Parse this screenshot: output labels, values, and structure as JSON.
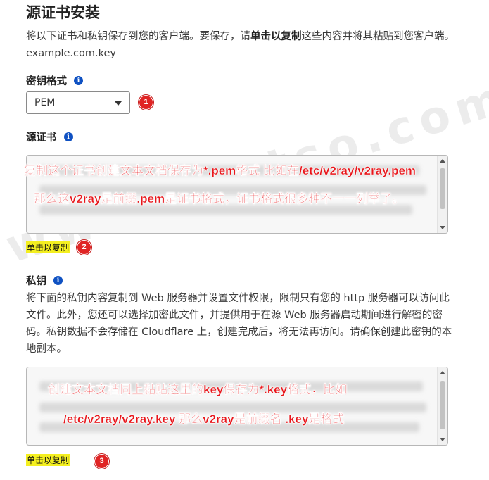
{
  "page": {
    "title": "源证书安装",
    "intro_prefix": "将以下证书和私钥保存到您的客户端。要保存，请",
    "intro_bold": "单击以复制",
    "intro_suffix": "这些内容并将其粘贴到您客户端。",
    "intro_line2": "example.com.key"
  },
  "key_format": {
    "label": "密钥格式",
    "info_icon": "i",
    "selected": "PEM",
    "marker": "1"
  },
  "origin_cert": {
    "label": "源证书",
    "info_icon": "i",
    "annotation_line1": "复制这个证书创建文本文档保存为*.pem格式 比如在/etc/v2ray/v2ray.pem",
    "annotation_line2": "那么这v2ray是前缀.pem是证书格式，证书格式很多种不一一列举了。",
    "copy_label": "单击以复制",
    "marker": "2"
  },
  "private_key": {
    "label": "私钥",
    "info_icon": "i",
    "description": "将下面的私钥内容复制到 Web 服务器并设置文件权限，限制只有您的 http 服务器可以访问此文件。此外，您还可以选择加密此文件，并提供用于在源 Web 服务器启动期间进行解密的密码。私钥数据不会存储在 Cloudflare 上，创建完成后，将无法再访问。请确保创建此密钥的本地副本。",
    "annotation_line1": "创建文本文档同上黏贴这里的key保存为*.key格式，比如",
    "annotation_line2": "/etc/v2ray/v2ray.key 那么v2ray是前缀名 .key是格式",
    "copy_label": "单击以复制",
    "marker": "3"
  },
  "watermark": "www.rootso.com",
  "colors": {
    "info_blue": "#0f51c2",
    "annotation_red": "#e8161b",
    "highlight_yellow": "#f4ef20",
    "marker_red": "#e02424"
  }
}
